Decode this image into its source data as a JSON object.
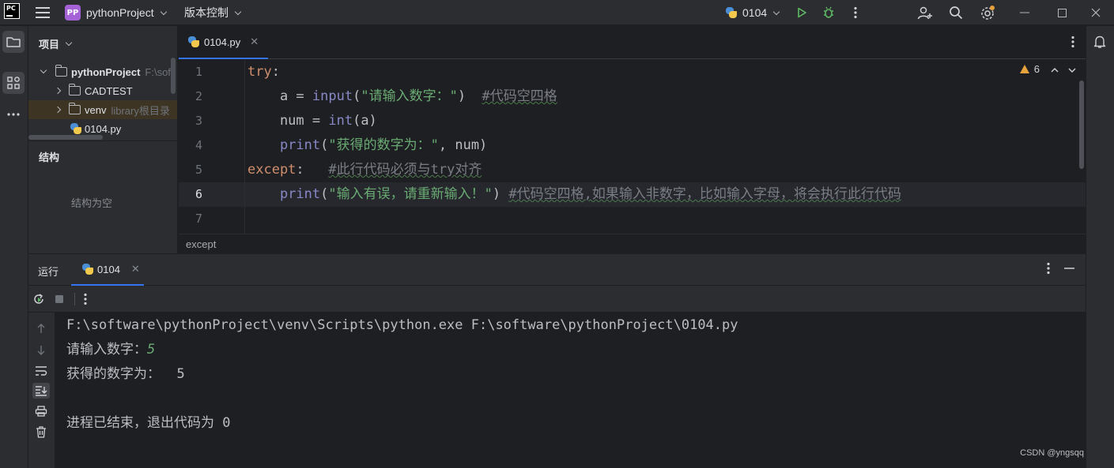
{
  "titlebar": {
    "logo": "PC",
    "project_badge": "PP",
    "project_name": "pythonProject",
    "vcs_menu": "版本控制",
    "run_config": "0104",
    "icons": [
      "hamburger-menu-icon",
      "run-icon",
      "debug-icon",
      "more-vertical-icon",
      "add-user-icon",
      "search-icon",
      "settings-icon",
      "minimize-icon",
      "maximize-icon",
      "close-icon"
    ],
    "accent_colors": {
      "run": "#5fb865",
      "settings_badge": "#e6a23c",
      "project_badge": "#a562d6"
    }
  },
  "left_strip": {
    "icons": [
      "project-folder-icon",
      "structure-icon",
      "more-horizontal-icon"
    ]
  },
  "right_strip": {
    "icons": [
      "notifications-bell-icon"
    ]
  },
  "project_panel": {
    "header": "项目",
    "tree": [
      {
        "label": "pythonProject",
        "hint": "F:\\soft",
        "type": "root"
      },
      {
        "label": "CADTEST",
        "hint": "",
        "type": "folder"
      },
      {
        "label": "venv",
        "hint": "library根目录",
        "type": "folder"
      },
      {
        "label": "0104.py",
        "hint": "",
        "type": "python-file"
      }
    ],
    "structure_title": "结构",
    "structure_empty": "结构为空"
  },
  "editor": {
    "tab_label": "0104.py",
    "warnings_count": "6",
    "line_numbers": [
      "1",
      "2",
      "3",
      "4",
      "5",
      "6",
      "7"
    ],
    "lines": {
      "l1_kw": "try",
      "l1_punct": ":",
      "l2_pre": "    a = ",
      "l2_fn": "input",
      "l2_open": "(",
      "l2_str": "\"请输入数字：\"",
      "l2_close": ")  ",
      "l2_cmt": "#代码空四格",
      "l3_pre": "    num = ",
      "l3_fn": "int",
      "l3_rest": "(a)",
      "l4_pre": "    ",
      "l4_fn": "print",
      "l4_open": "(",
      "l4_str": "\"获得的数字为：\"",
      "l4_rest": ", num)",
      "l5_kw": "except",
      "l5_punct": ":   ",
      "l5_cmt": "#此行代码必须与try对齐",
      "l6_pre": "    ",
      "l6_fn": "print",
      "l6_open": "(",
      "l6_str": "\"输入有误，请重新输入！\"",
      "l6_close": ") ",
      "l6_cmt": "#代码空四格,如果输入非数字，比如输入字母，将会执行此行代码"
    },
    "breadcrumb": "except",
    "syntax_colors": {
      "keyword": "#cf8e6d",
      "builtin": "#8888c6",
      "string": "#6aab73",
      "comment": "#7a7e85"
    }
  },
  "run_window": {
    "title": "运行",
    "tab_label": "0104",
    "toolbar_icons": [
      "rerun-icon",
      "stop-icon",
      "more-vertical-icon"
    ],
    "gutter_icons": [
      "scroll-up-icon",
      "scroll-down-icon",
      "soft-wrap-icon",
      "scroll-to-end-icon",
      "print-icon",
      "delete-icon"
    ],
    "console": {
      "cmd": "F:\\software\\pythonProject\\venv\\Scripts\\python.exe F:\\software\\pythonProject\\0104.py",
      "prompt": "请输入数字：",
      "user_input": "5",
      "result": "获得的数字为：  5",
      "exit": "进程已结束，退出代码为 0"
    }
  },
  "watermark": "CSDN @yngsqq"
}
